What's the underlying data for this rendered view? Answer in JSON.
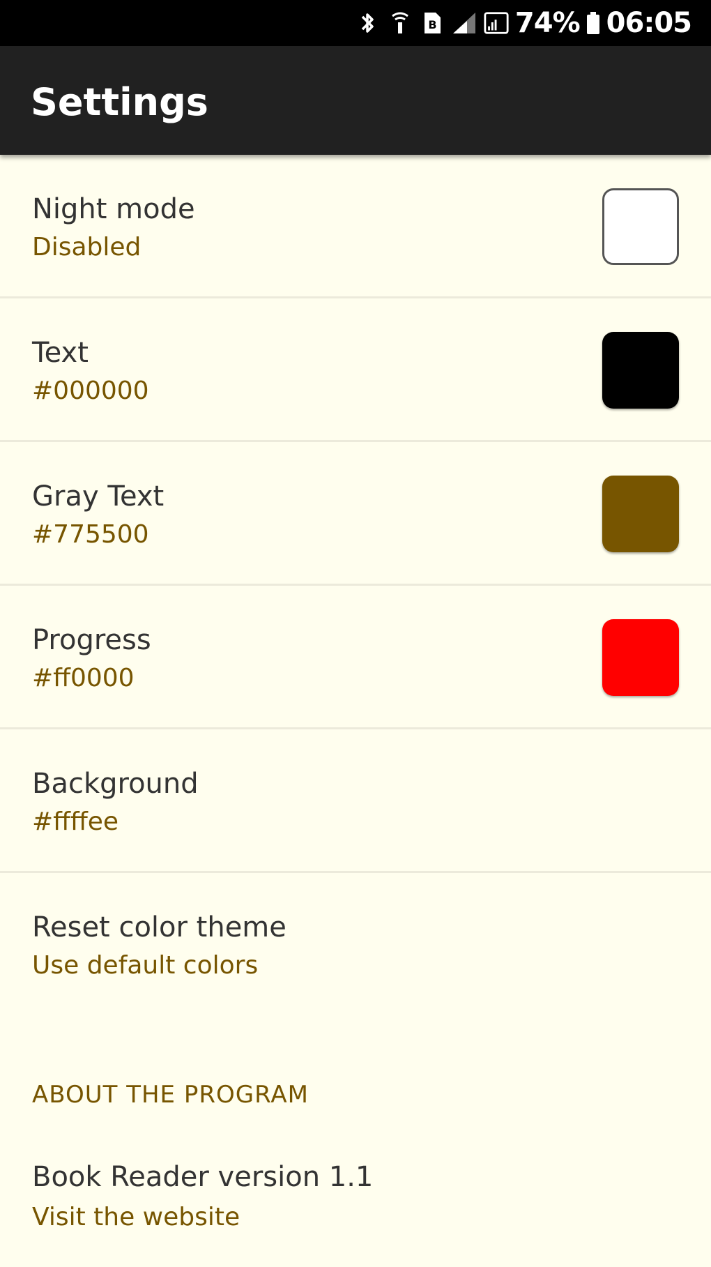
{
  "status_bar": {
    "battery_percent": "74%",
    "time": "06:05",
    "icons": [
      "bluetooth-icon",
      "wifi-calling-icon",
      "sim-icon",
      "signal-icon",
      "cast-icon",
      "battery-icon"
    ]
  },
  "app_bar": {
    "title": "Settings"
  },
  "preferences": [
    {
      "title": "Night mode",
      "summary": "Disabled",
      "swatch_color": "#ffffff"
    },
    {
      "title": "Text",
      "summary": "#000000",
      "swatch_color": "#000000"
    },
    {
      "title": "Gray Text",
      "summary": "#775500",
      "swatch_color": "#775500"
    },
    {
      "title": "Progress",
      "summary": "#ff0000",
      "swatch_color": "#ff0000"
    },
    {
      "title": "Background",
      "summary": "#ffffee"
    },
    {
      "title": "Reset color theme",
      "summary": "Use default colors"
    }
  ],
  "about": {
    "section_header": "ABOUT THE PROGRAM",
    "title": "Book Reader version 1.1",
    "summary": "Visit the website"
  },
  "colors": {
    "background": "#fffeee",
    "app_bar": "#212121",
    "status_bar": "#000000",
    "summary_text": "#775500",
    "title_text": "#333333"
  }
}
